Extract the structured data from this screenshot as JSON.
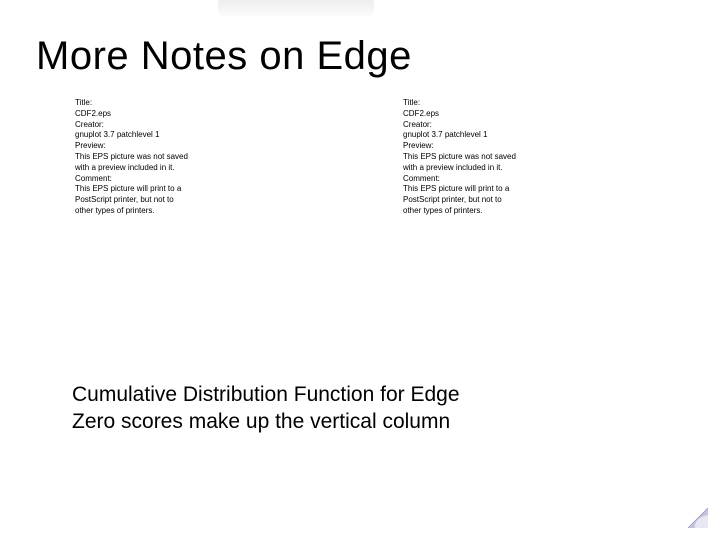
{
  "title": "More Notes on Edge",
  "eps_left": {
    "title_label": "Title:",
    "title_value": "CDF2.eps",
    "creator_label": "Creator:",
    "creator_value": "gnuplot 3.7 patchlevel 1",
    "preview_label": "Preview:",
    "preview_text_1": "This EPS picture was not saved",
    "preview_text_2": "with a preview included in it.",
    "comment_label": "Comment:",
    "comment_text_1": "This EPS picture will print to a",
    "comment_text_2": "PostScript printer, but not to",
    "comment_text_3": "other types of printers."
  },
  "eps_right": {
    "title_label": "Title:",
    "title_value": "CDF2.eps",
    "creator_label": "Creator:",
    "creator_value": "gnuplot 3.7 patchlevel 1",
    "preview_label": "Preview:",
    "preview_text_1": "This EPS picture was not saved",
    "preview_text_2": "with a preview included in it.",
    "comment_label": "Comment:",
    "comment_text_1": "This EPS picture will print to a",
    "comment_text_2": "PostScript printer, but not to",
    "comment_text_3": "other types of printers."
  },
  "bottom_line_1": "Cumulative Distribution Function for Edge",
  "bottom_line_2": "Zero scores make up the vertical column",
  "corner_color": "#b0b0d0"
}
